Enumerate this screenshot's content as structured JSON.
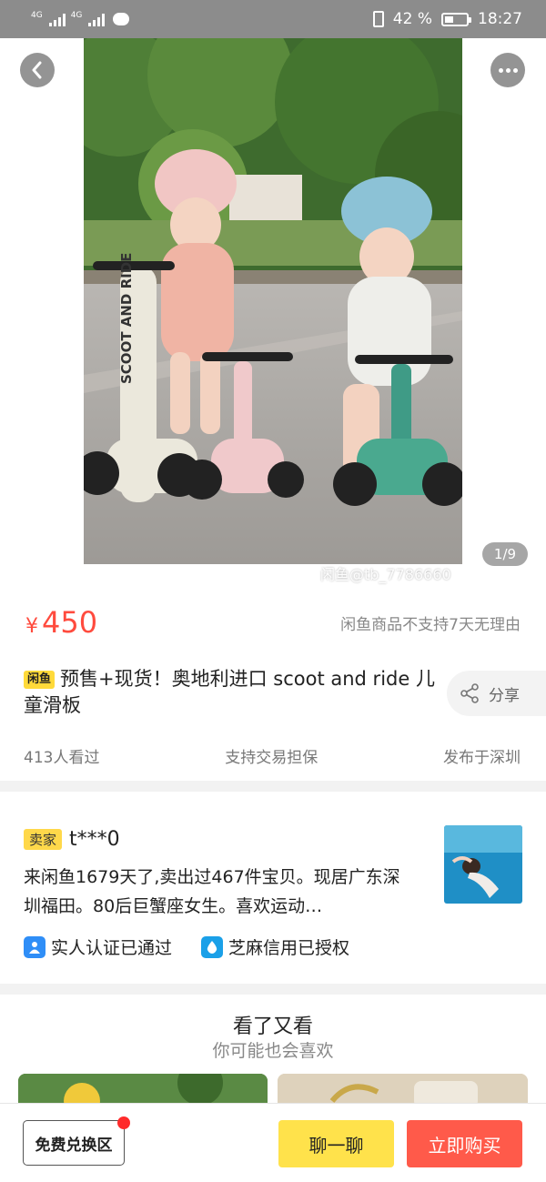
{
  "status_bar": {
    "network_1": "4G",
    "network_2": "4G",
    "battery_percent": "42 %",
    "battery_level": 0.42,
    "time": "18:27"
  },
  "hero": {
    "counter": "1/9",
    "watermark": "闲鱼@tb_7786660",
    "scooter_text": "SCOOT AND RIDE",
    "back_icon": "chevron-left-icon",
    "more_icon": "more-dots-icon"
  },
  "price": {
    "currency": "¥",
    "value": "450",
    "note": "闲鱼商品不支持7天无理由"
  },
  "product": {
    "tag": "闲鱼",
    "title": "预售+现货！奥地利进口 scoot and ride 儿童滑板",
    "share_label": "分享"
  },
  "meta": {
    "views": "413人看过",
    "guarantee": "支持交易担保",
    "location": "发布于深圳"
  },
  "seller": {
    "tag": "卖家",
    "name": "t***0",
    "bio": "来闲鱼1679天了,卖出过467件宝贝。现居广东深圳福田。80后巨蟹座女生。喜欢运动…",
    "badge_identity": "实人认证已通过",
    "badge_credit": "芝麻信用已授权"
  },
  "recommend": {
    "title": "看了又看",
    "subtitle": "你可能也会喜欢"
  },
  "bottom_bar": {
    "swap_label": "免费兑换区",
    "chat_label": "聊一聊",
    "buy_label": "立即购买"
  },
  "colors": {
    "price_red": "#ff4b3e",
    "chat_yellow": "#ffe24b",
    "buy_red": "#ff5a4a",
    "tag_yellow": "#ffd84a"
  }
}
